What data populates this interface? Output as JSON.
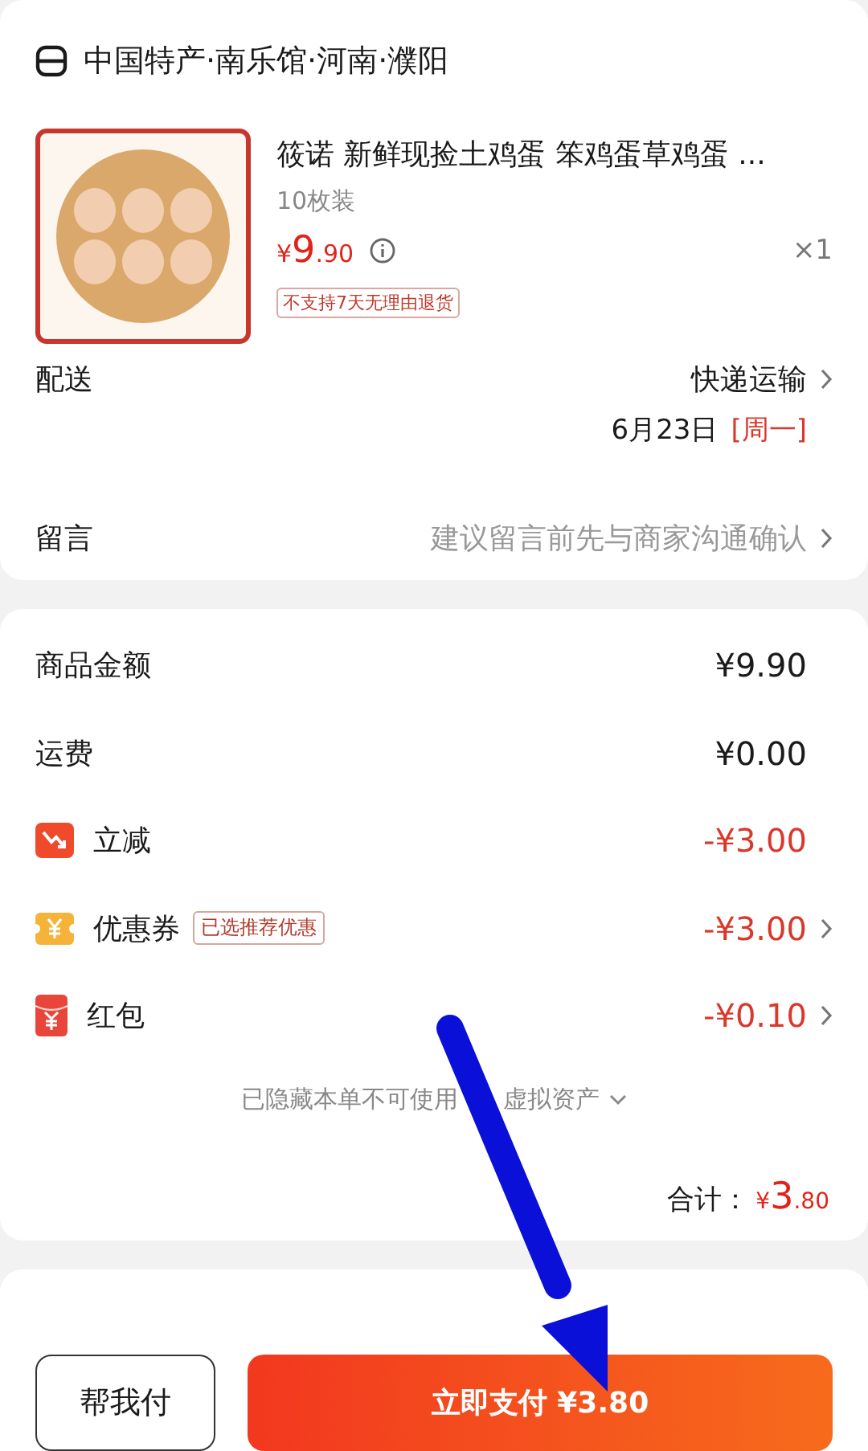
{
  "store": {
    "name": "中国特产·南乐馆·河南·濮阳"
  },
  "product": {
    "title": "筱诺 新鲜现捡土鸡蛋 笨鸡蛋草鸡蛋 ...",
    "spec": "10枚装",
    "price_symbol": "¥",
    "price_int": "9",
    "price_dec": ".90",
    "quantity": "×1",
    "badge": "不支持7天无理由退货"
  },
  "delivery": {
    "label": "配送",
    "method": "快递运输",
    "date": "6月23日",
    "weekday": "[周一]"
  },
  "message": {
    "label": "留言",
    "placeholder": "建议留言前先与商家沟通确认"
  },
  "fees": [
    {
      "kind": "plain",
      "label": "商品金额",
      "amount": "¥9.90",
      "chevron": false
    },
    {
      "kind": "plain",
      "label": "运费",
      "amount": "¥0.00",
      "chevron": false
    },
    {
      "kind": "instant",
      "label": "立减",
      "amount": "-¥3.00",
      "chevron": false
    },
    {
      "kind": "coupon",
      "label": "优惠券",
      "tag": "已选推荐优惠",
      "amount": "-¥3.00",
      "chevron": true
    },
    {
      "kind": "redpacket",
      "label": "红包",
      "amount": "-¥0.10",
      "chevron": true
    }
  ],
  "hidden_assets": {
    "text_before": "已隐藏本单不可使用",
    "text_after": "虚拟资产"
  },
  "total": {
    "label": "合计：",
    "symbol": "¥",
    "int": "3",
    "dec": ".80"
  },
  "actions": {
    "secondary": "帮我付",
    "primary": "立即支付 ¥3.80"
  }
}
